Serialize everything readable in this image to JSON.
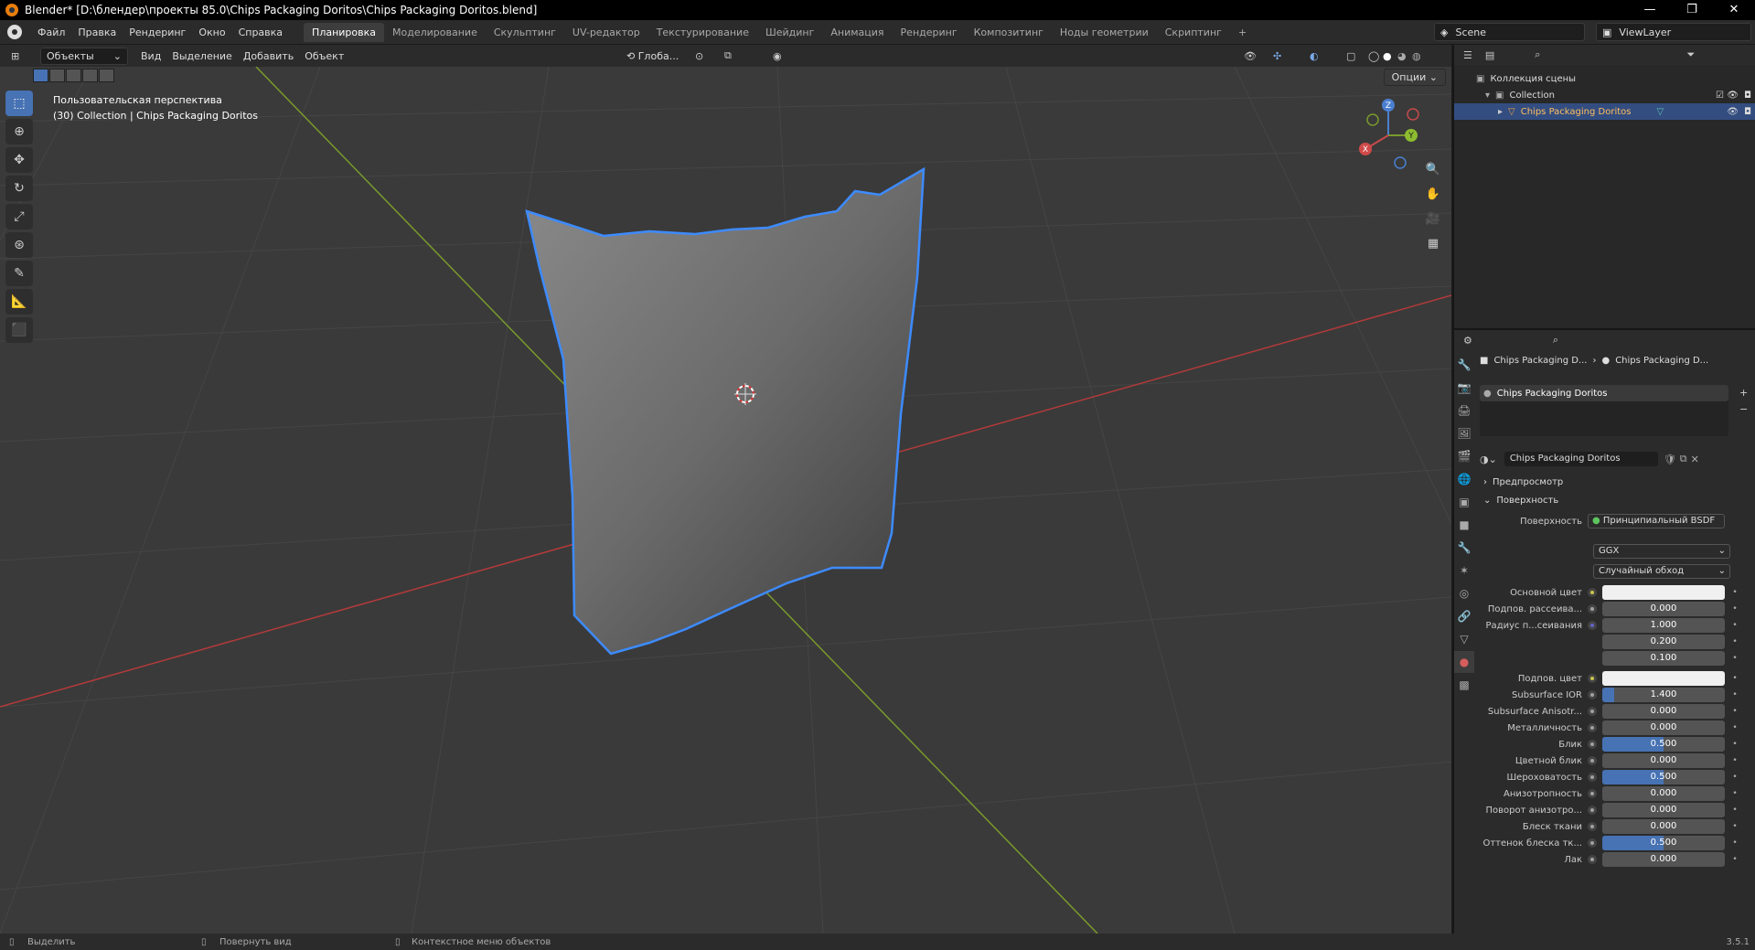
{
  "window": {
    "title": "Blender* [D:\\блендер\\проекты 85.0\\Chips Packaging  Doritos\\Chips Packaging  Doritos.blend]",
    "controls": [
      "—",
      "❐",
      "✕"
    ]
  },
  "menu": [
    "Файл",
    "Правка",
    "Рендеринг",
    "Окно",
    "Справка"
  ],
  "workspaces": [
    "Планировка",
    "Моделирование",
    "Скульптинг",
    "UV-редактор",
    "Текстурирование",
    "Шейдинг",
    "Анимация",
    "Рендеринг",
    "Композитинг",
    "Ноды геометрии",
    "Скриптинг",
    "+"
  ],
  "active_workspace": "Планировка",
  "scene": {
    "name": "Scene",
    "view_layer": "ViewLayer"
  },
  "viewport_header": {
    "mode": "Объекты",
    "menus": [
      "Вид",
      "Выделение",
      "Добавить",
      "Объект"
    ],
    "orientation": "Глоба...",
    "options": "Опции"
  },
  "viewport": {
    "perspective": "Пользовательская перспектива",
    "collection_info": "(30) Collection | Chips Packaging  Doritos",
    "axes": {
      "x": "X",
      "y": "Y",
      "z": "Z"
    }
  },
  "outliner": {
    "root": "Коллекция сцены",
    "collection": "Collection",
    "object": "Chips Packaging  Doritos"
  },
  "properties": {
    "breadcrumb": [
      "Chips Packaging  D...",
      "Chips Packaging  D..."
    ],
    "slot": "Chips Packaging  Doritos",
    "material_name": "Chips Packaging  Doritos",
    "sections": {
      "preview": "Предпросмотр",
      "surface": "Поверхность"
    },
    "surface_label": "Поверхность",
    "surface_shader": "Принципиальный BSDF",
    "distribution": "GGX",
    "subsurface_method": "Случайный обход",
    "rows": [
      {
        "label": "Основной цвет",
        "value": "",
        "fill": 0,
        "color": "white",
        "socket": "y"
      },
      {
        "label": "Подпов. рассеива...",
        "value": "0.000",
        "fill": 0,
        "socket": "g"
      },
      {
        "label": "Радиус п...сеивания",
        "value": "1.000",
        "fill": 0,
        "socket": "b"
      },
      {
        "label": "",
        "value": "0.200",
        "fill": 0,
        "socket": ""
      },
      {
        "label": "",
        "value": "0.100",
        "fill": 0,
        "socket": ""
      },
      {
        "label": "Подпов. цвет",
        "value": "",
        "fill": 0,
        "color": "white",
        "socket": "y"
      },
      {
        "label": "Subsurface IOR",
        "value": "1.400",
        "fill": 0.1,
        "socket": "g"
      },
      {
        "label": "Subsurface Anisotr...",
        "value": "0.000",
        "fill": 0,
        "socket": "g"
      },
      {
        "label": "Металличность",
        "value": "0.000",
        "fill": 0,
        "socket": "g"
      },
      {
        "label": "Блик",
        "value": "0.500",
        "fill": 0.5,
        "socket": "g"
      },
      {
        "label": "Цветной блик",
        "value": "0.000",
        "fill": 0,
        "socket": "g"
      },
      {
        "label": "Шероховатость",
        "value": "0.500",
        "fill": 0.5,
        "socket": "g"
      },
      {
        "label": "Анизотропность",
        "value": "0.000",
        "fill": 0,
        "socket": "g"
      },
      {
        "label": "Поворот анизотро...",
        "value": "0.000",
        "fill": 0,
        "socket": "g"
      },
      {
        "label": "Блеск ткани",
        "value": "0.000",
        "fill": 0,
        "socket": "g"
      },
      {
        "label": "Оттенок блеска тк...",
        "value": "0.500",
        "fill": 0.5,
        "socket": "g"
      },
      {
        "label": "Лак",
        "value": "0.000",
        "fill": 0,
        "socket": "g"
      }
    ]
  },
  "status": {
    "select": "Выделить",
    "rotate": "Повернуть вид",
    "context": "Контекстное меню объектов",
    "version": "3.5.1"
  },
  "colors": {
    "accent": "#4772b3",
    "selection_outline": "#3d8bff",
    "x_axis": "#b33a3a",
    "y_axis": "#7a9a2c"
  }
}
